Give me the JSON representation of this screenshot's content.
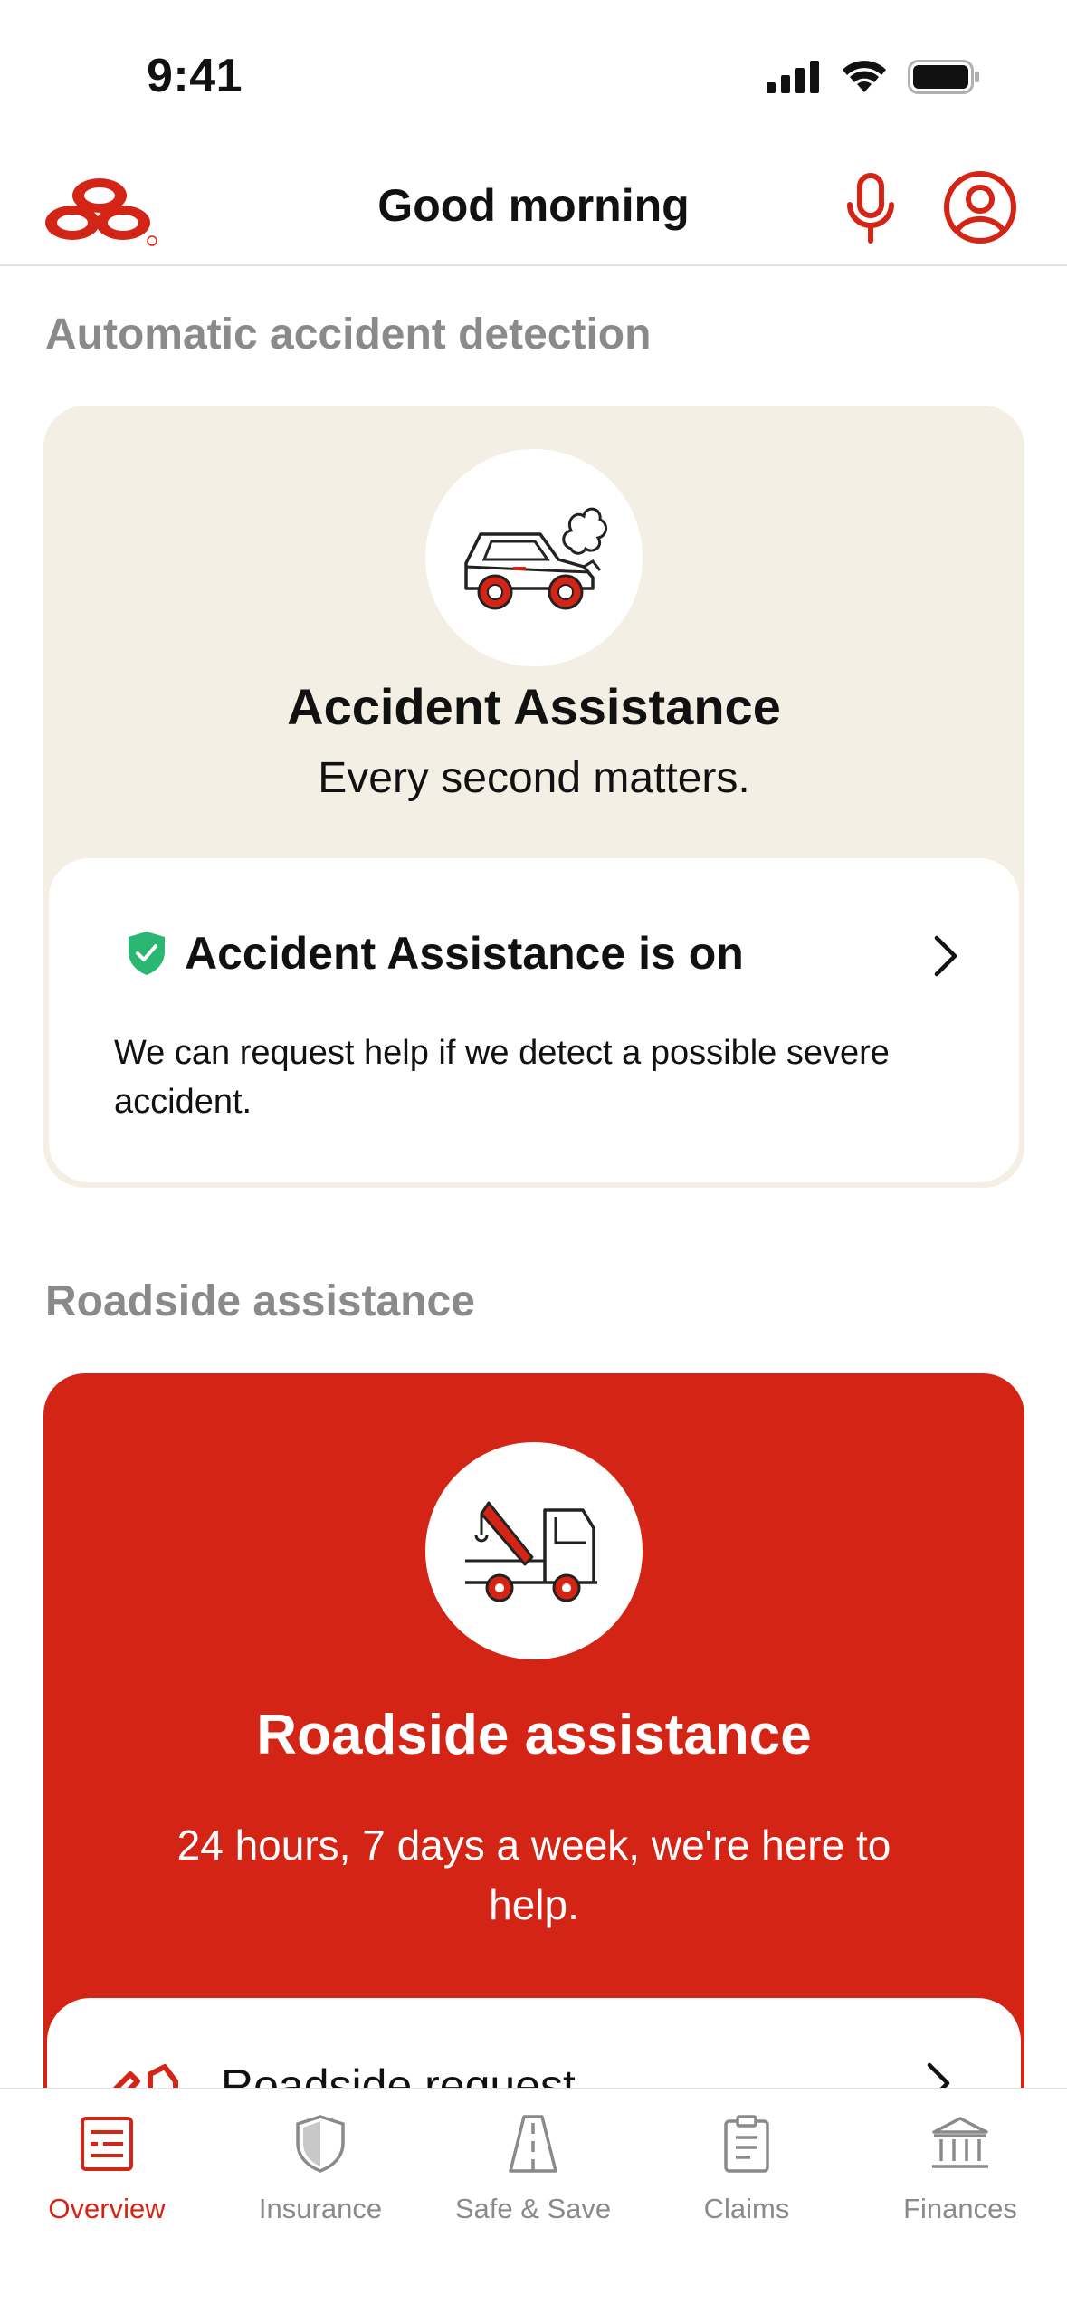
{
  "status_bar": {
    "time": "9:41"
  },
  "header": {
    "title": "Good morning"
  },
  "sections": {
    "accident_label": "Automatic accident detection",
    "roadside_label": "Roadside assistance"
  },
  "accident_card": {
    "title": "Accident Assistance",
    "subtitle": "Every second matters.",
    "status_text": "Accident Assistance is on",
    "description": "We can request help if we detect a possible severe accident."
  },
  "roadside_card": {
    "title": "Roadside assistance",
    "subtitle": "24 hours, 7 days a week, we're here to help.",
    "request_label": "Roadside request"
  },
  "tabs": [
    {
      "label": "Overview",
      "icon": "overview-icon",
      "active": true
    },
    {
      "label": "Insurance",
      "icon": "shield-icon",
      "active": false
    },
    {
      "label": "Safe & Save",
      "icon": "road-icon",
      "active": false
    },
    {
      "label": "Claims",
      "icon": "clipboard-icon",
      "active": false
    },
    {
      "label": "Finances",
      "icon": "bank-icon",
      "active": false
    }
  ],
  "colors": {
    "brand_red": "#d42415",
    "card_beige": "#f4efe4",
    "success_green": "#2bb673",
    "muted_gray": "#8a8a8a"
  }
}
